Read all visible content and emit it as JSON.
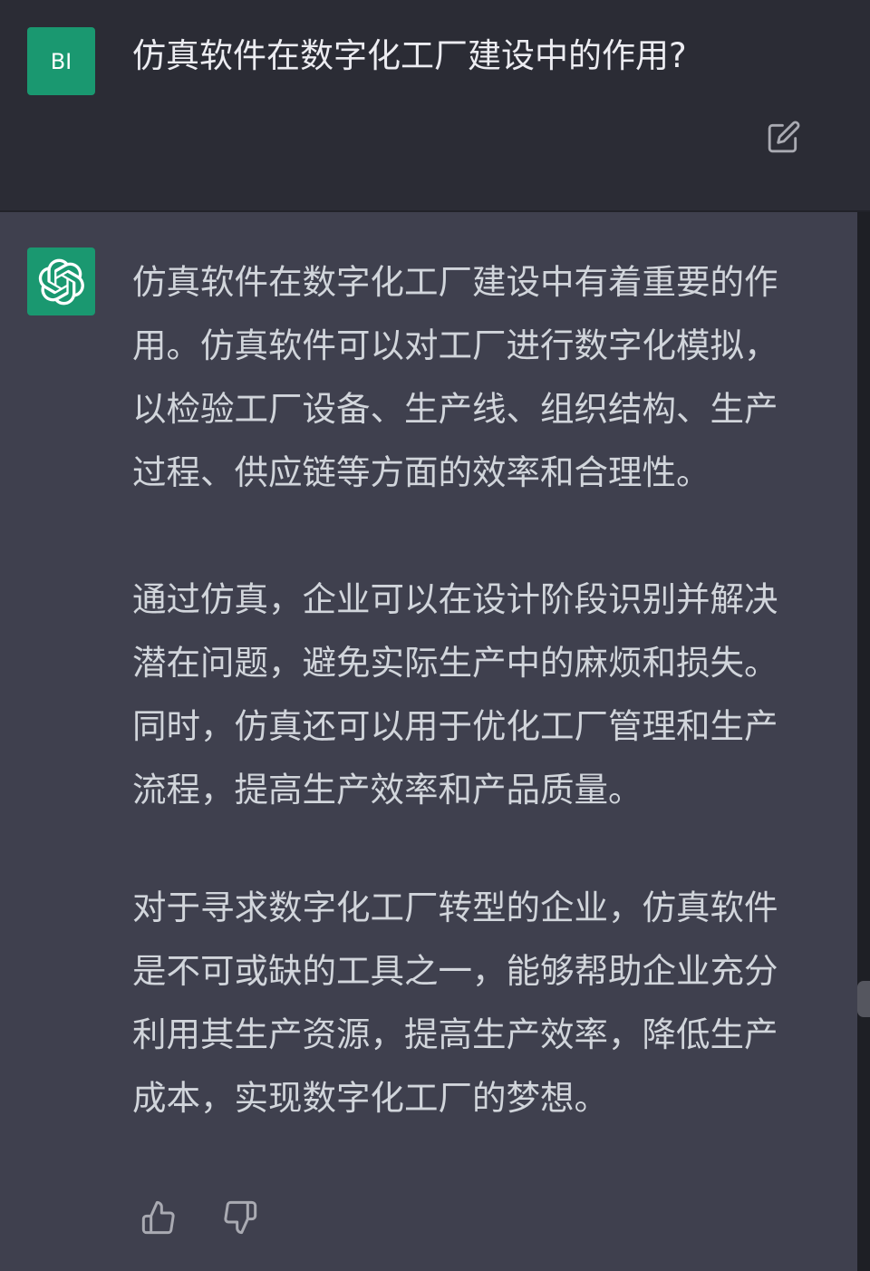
{
  "user": {
    "avatar_initials": "BI",
    "question": "仿真软件在数字化工厂建设中的作用?",
    "edit_icon": "edit-icon"
  },
  "assistant": {
    "avatar_icon": "openai-logo-icon",
    "paragraphs": [
      "仿真软件在数字化工厂建设中有着重要的作用。仿真软件可以对工厂进行数字化模拟，以检验工厂设备、生产线、组织结构、生产过程、供应链等方面的效率和合理性。",
      "通过仿真，企业可以在设计阶段识别并解决潜在问题，避免实际生产中的麻烦和损失。同时，仿真还可以用于优化工厂管理和生产流程，提高生产效率和产品质量。",
      "对于寻求数字化工厂转型的企业，仿真软件是不可或缺的工具之一，能够帮助企业充分利用其生产资源，提高生产效率，降低生产成本，实现数字化工厂的梦想。"
    ],
    "feedback_icons": [
      "thumbs-up-icon",
      "thumbs-down-icon"
    ]
  },
  "colors": {
    "user_bg": "#2b2c35",
    "assistant_bg": "#3f404e",
    "avatar_green": "#1a9870",
    "text": "#d1d5db"
  }
}
